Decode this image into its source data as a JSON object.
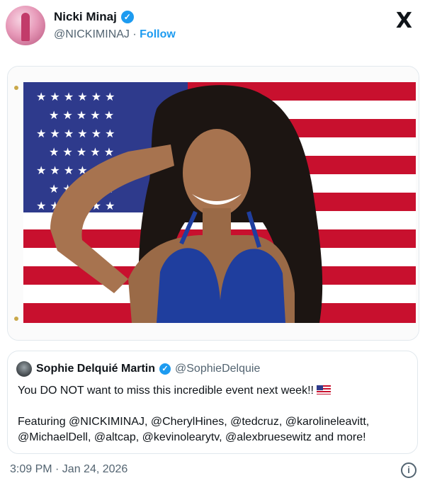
{
  "author": {
    "name": "Nicki Minaj",
    "handle": "@NICKIMINAJ",
    "separator": "·",
    "follow_label": "Follow",
    "verified_icon": "verified-badge-icon"
  },
  "brand": {
    "logo": "X"
  },
  "media": {
    "subject": "flag-photo"
  },
  "quoted": {
    "name": "Sophie Delquié Martin",
    "handle": "@SophieDelquie",
    "line1": "You DO NOT want to miss this incredible event next week!!",
    "line2": "Featuring @NICKIMINAJ, @CherylHines, @tedcruz, @karolineleavitt,",
    "line3": "@MichaelDell, @altcap, @kevinolearytv, @alexbruesewitz and more!"
  },
  "footer": {
    "timestamp": "3:09 PM · Jan 24, 2026"
  },
  "colors": {
    "accent": "#1d9bf0",
    "muted": "#536471",
    "flag_red": "#c8102e",
    "flag_blue": "#2e3a8c"
  }
}
